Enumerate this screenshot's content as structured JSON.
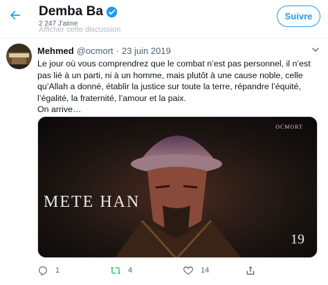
{
  "header": {
    "title": "Demba Ba",
    "subtitle": "2 247 J'aime",
    "ghost_text": "Afficher cette discussion",
    "follow_label": "Suivre"
  },
  "tweet": {
    "author_name": "Mehmed",
    "handle": "@ocmort",
    "separator": "·",
    "date": "23 juin 2019",
    "text_line1": "Le jour où vous comprendrez que le combat n’est pas personnel, il n’est pas lié à un parti, ni à un homme, mais plutôt à une cause noble, celle qu’Allah a donné, établir la justice sur toute la terre, répandre l’équité, l’égalité, la fraternité, l’amour et la paix.",
    "text_line2": "On arrive…",
    "media": {
      "brand": "OCMORT",
      "title": "METE HAN",
      "number": "19"
    },
    "actions": {
      "reply_count": "1",
      "retweet_count": "4",
      "like_count": "14"
    }
  },
  "colors": {
    "accent": "#1d9bf0",
    "text": "#0f1419",
    "secondary": "#536471",
    "retweet_icon": "#17bf63"
  },
  "icons": [
    "back-arrow-icon",
    "verified-badge-icon",
    "chevron-down-icon",
    "reply-icon",
    "retweet-icon",
    "like-icon",
    "share-icon"
  ]
}
